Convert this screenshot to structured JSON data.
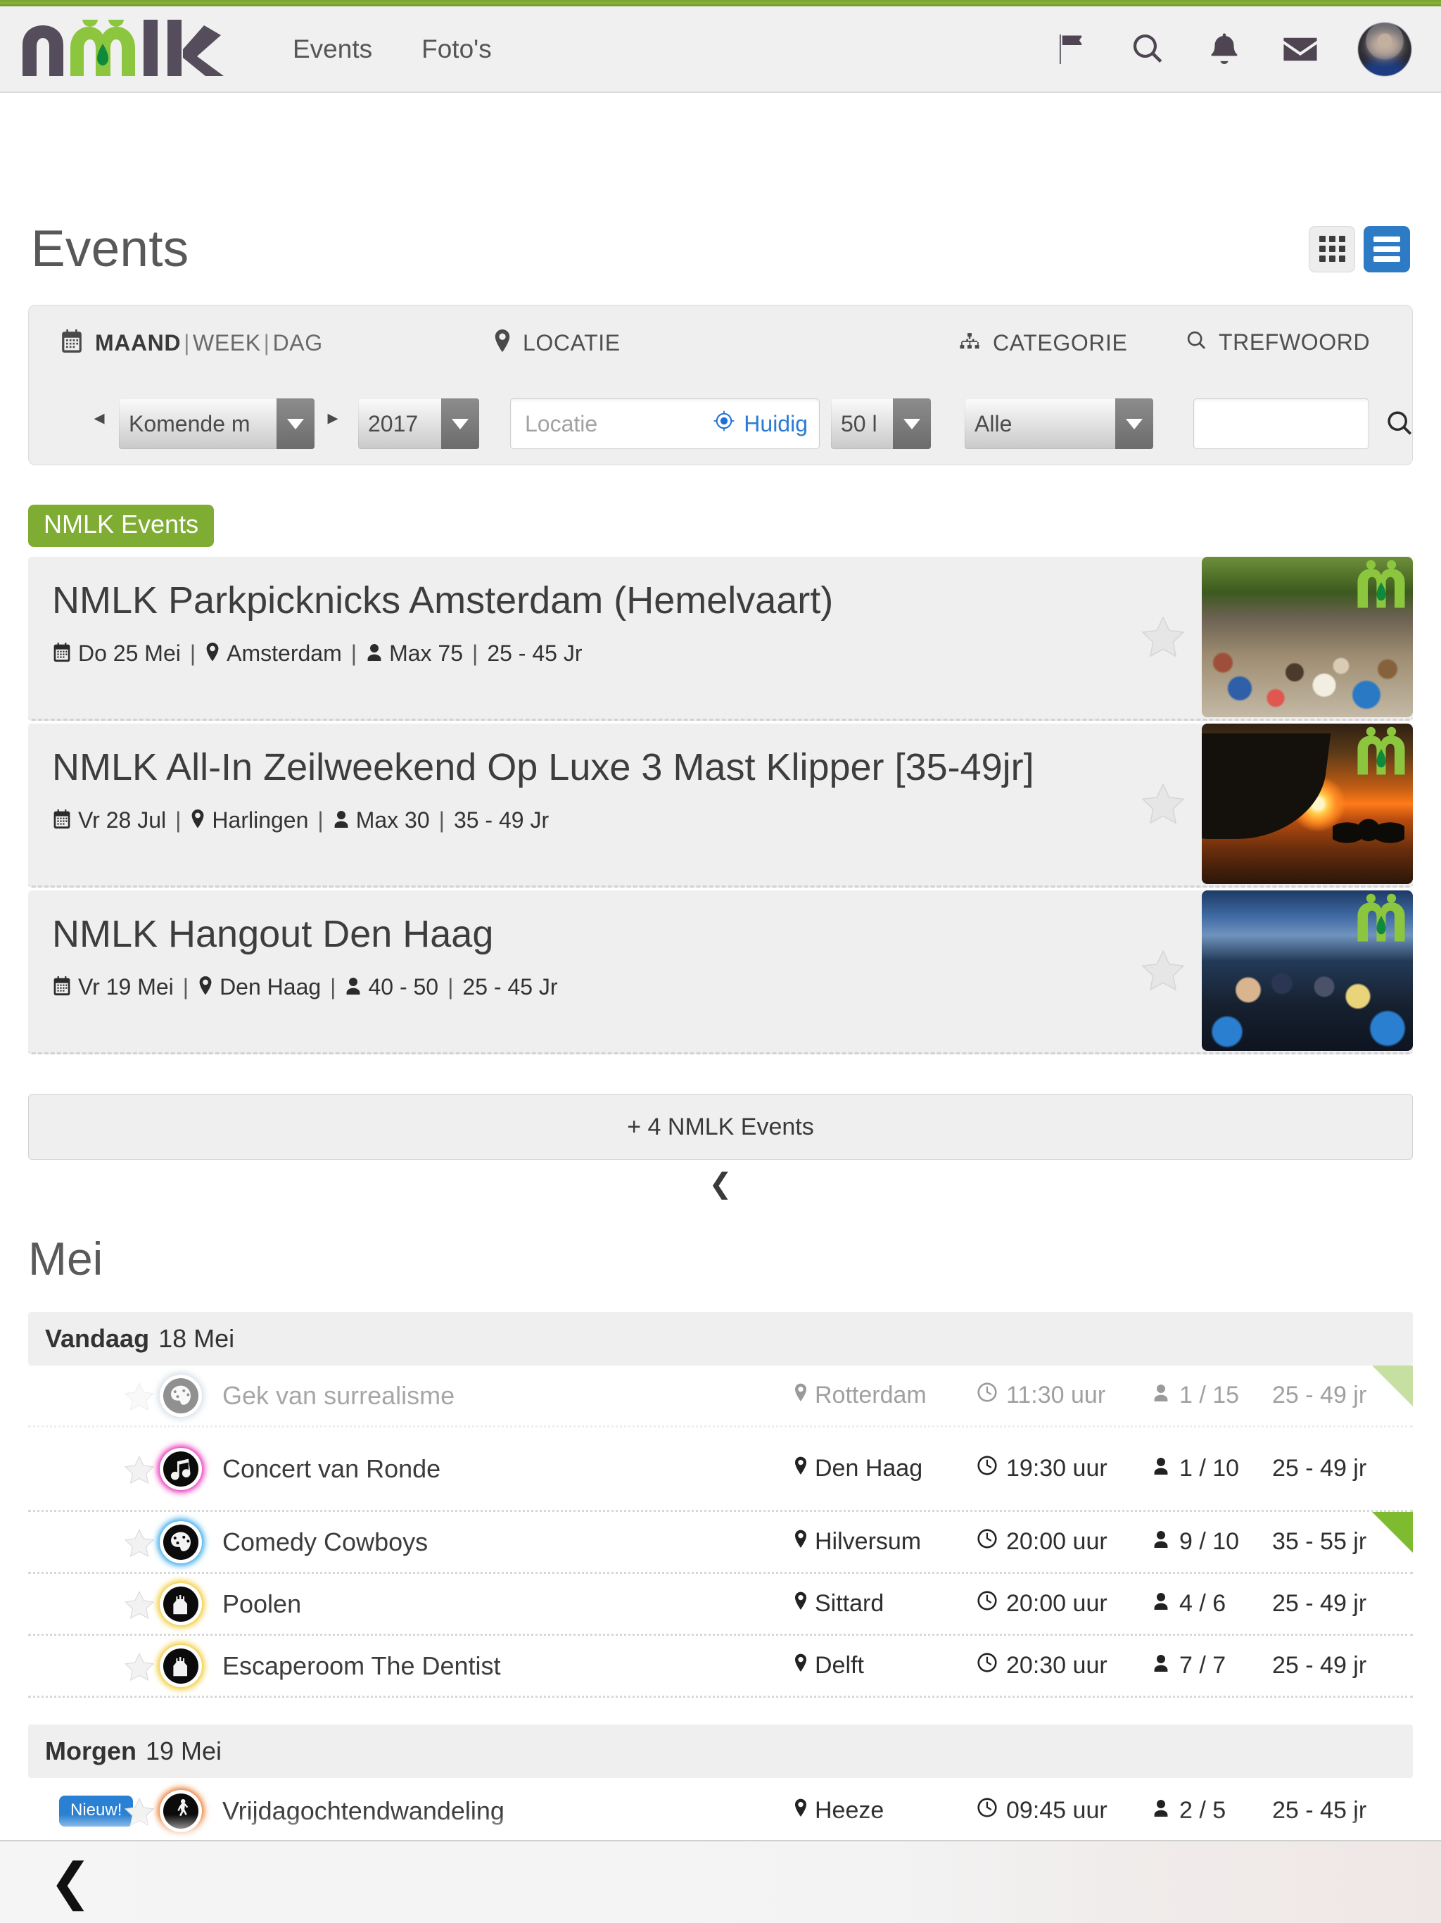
{
  "brand": {
    "logo_text": "nmlk",
    "accent_green": "#7fad33",
    "dark": "#4e4452"
  },
  "topnav": {
    "links": [
      {
        "label": "Events",
        "name": "nav-link-events"
      },
      {
        "label": "Foto's",
        "name": "nav-link-fotos"
      }
    ],
    "icons": [
      "flag-icon",
      "search-icon",
      "bell-icon",
      "envelope-icon",
      "avatar"
    ]
  },
  "header": {
    "title": "Events",
    "view_toggle": {
      "grid_label": "grid-view",
      "list_label": "list-view",
      "active": "list",
      "active_color": "#2d7bc4"
    }
  },
  "filters": {
    "date": {
      "icon": "calendar-icon",
      "maand": "MAAND",
      "week": "WEEK",
      "dag": "DAG",
      "sep": "|",
      "active": "MAAND"
    },
    "locatie": {
      "icon": "map-pin-icon",
      "label": "LOCATIE"
    },
    "categorie": {
      "icon": "sitemap-icon",
      "label": "CATEGORIE"
    },
    "trefwoord": {
      "icon": "search-icon",
      "label": "TREFWOORD"
    },
    "month_select": {
      "value": "Komende m",
      "caret": "chevron-down-icon"
    },
    "year_select": {
      "value": "2017",
      "caret": "chevron-down-icon"
    },
    "prev_arrow": "◂",
    "next_arrow": "▸",
    "location_input": {
      "placeholder": "Locatie",
      "value": "",
      "current_label": "Huidig",
      "current_icon": "crosshair-icon"
    },
    "distance_select": {
      "value": "50 l",
      "caret": "chevron-down-icon"
    },
    "category_select": {
      "value": "Alle",
      "caret": "chevron-down-icon"
    },
    "keyword_input": {
      "value": "",
      "placeholder": ""
    },
    "keyword_search_button": "search-icon"
  },
  "nmlk_section": {
    "tag": "NMLK Events",
    "events": [
      {
        "title": "NMLK Parkpicknicks Amsterdam (Hemelvaart)",
        "date": "Do 25 Mei",
        "location": "Amsterdam",
        "capacity": "Max 75",
        "age": "25 - 45 Jr",
        "thumb": "picnic-crowd-photo",
        "favorite": false
      },
      {
        "title": "NMLK All-In Zeilweekend Op Luxe 3 Mast Klipper [35-49jr]",
        "date": "Vr 28 Jul",
        "location": "Harlingen",
        "capacity": "Max 30",
        "age": "35 - 49 Jr",
        "thumb": "ship-sunset-photo",
        "favorite": false
      },
      {
        "title": "NMLK Hangout Den Haag",
        "date": "Vr 19 Mei",
        "location": "Den Haag",
        "capacity": "40 - 50",
        "age": "25 - 45 Jr",
        "thumb": "beach-night-photo",
        "favorite": false
      }
    ],
    "more_button": "+ 4 NMLK Events",
    "expand_icon": "chevron-down-icon"
  },
  "month": {
    "label": "Mei"
  },
  "daygroups": [
    {
      "prefix": "Vandaag",
      "date": "18 Mei",
      "rows": [
        {
          "badge": "",
          "name": "Gek van surrealisme",
          "location": "Rotterdam",
          "time": "11:30 uur",
          "seats": "1 / 15",
          "age": "25 - 49 jr",
          "cat_icon": "art-icon",
          "ring": "#9fb8c9",
          "muted": true,
          "flag": true
        },
        {
          "badge": "",
          "name": "Concert van Ronde",
          "location": "Den Haag",
          "time": "19:30 uur",
          "seats": "1 / 10",
          "age": "25 - 49 jr",
          "cat_icon": "music-icon",
          "ring": "#e81bb2",
          "muted": false,
          "flag": false
        },
        {
          "badge": "",
          "name": "Comedy Cowboys",
          "location": "Hilversum",
          "time": "20:00 uur",
          "seats": "9 / 10",
          "age": "35 - 55 jr",
          "cat_icon": "theatre-icon",
          "ring": "#1f9fe8",
          "muted": false,
          "flag": true
        },
        {
          "badge": "",
          "name": "Poolen",
          "location": "Sittard",
          "time": "20:00 uur",
          "seats": "4 / 6",
          "age": "25 - 49 jr",
          "cat_icon": "games-icon",
          "ring": "#f0c419",
          "muted": false,
          "flag": false
        },
        {
          "badge": "",
          "name": "Escaperoom The Dentist",
          "location": "Delft",
          "time": "20:30 uur",
          "seats": "7 / 7",
          "age": "25 - 49 jr",
          "cat_icon": "games-icon",
          "ring": "#f0c419",
          "muted": false,
          "flag": false
        }
      ]
    },
    {
      "prefix": "Morgen",
      "date": "19 Mei",
      "rows": [
        {
          "badge": "Nieuw!",
          "name": "Vrijdagochtendwandeling",
          "location": "Heeze",
          "time": "09:45 uur",
          "seats": "2 / 5",
          "age": "25 - 45 jr",
          "cat_icon": "walking-icon",
          "ring": "#e8701f",
          "muted": false,
          "flag": false
        }
      ]
    }
  ],
  "bottombar": {
    "back_icon": "chevron-left-icon"
  },
  "meta_separator": "|"
}
